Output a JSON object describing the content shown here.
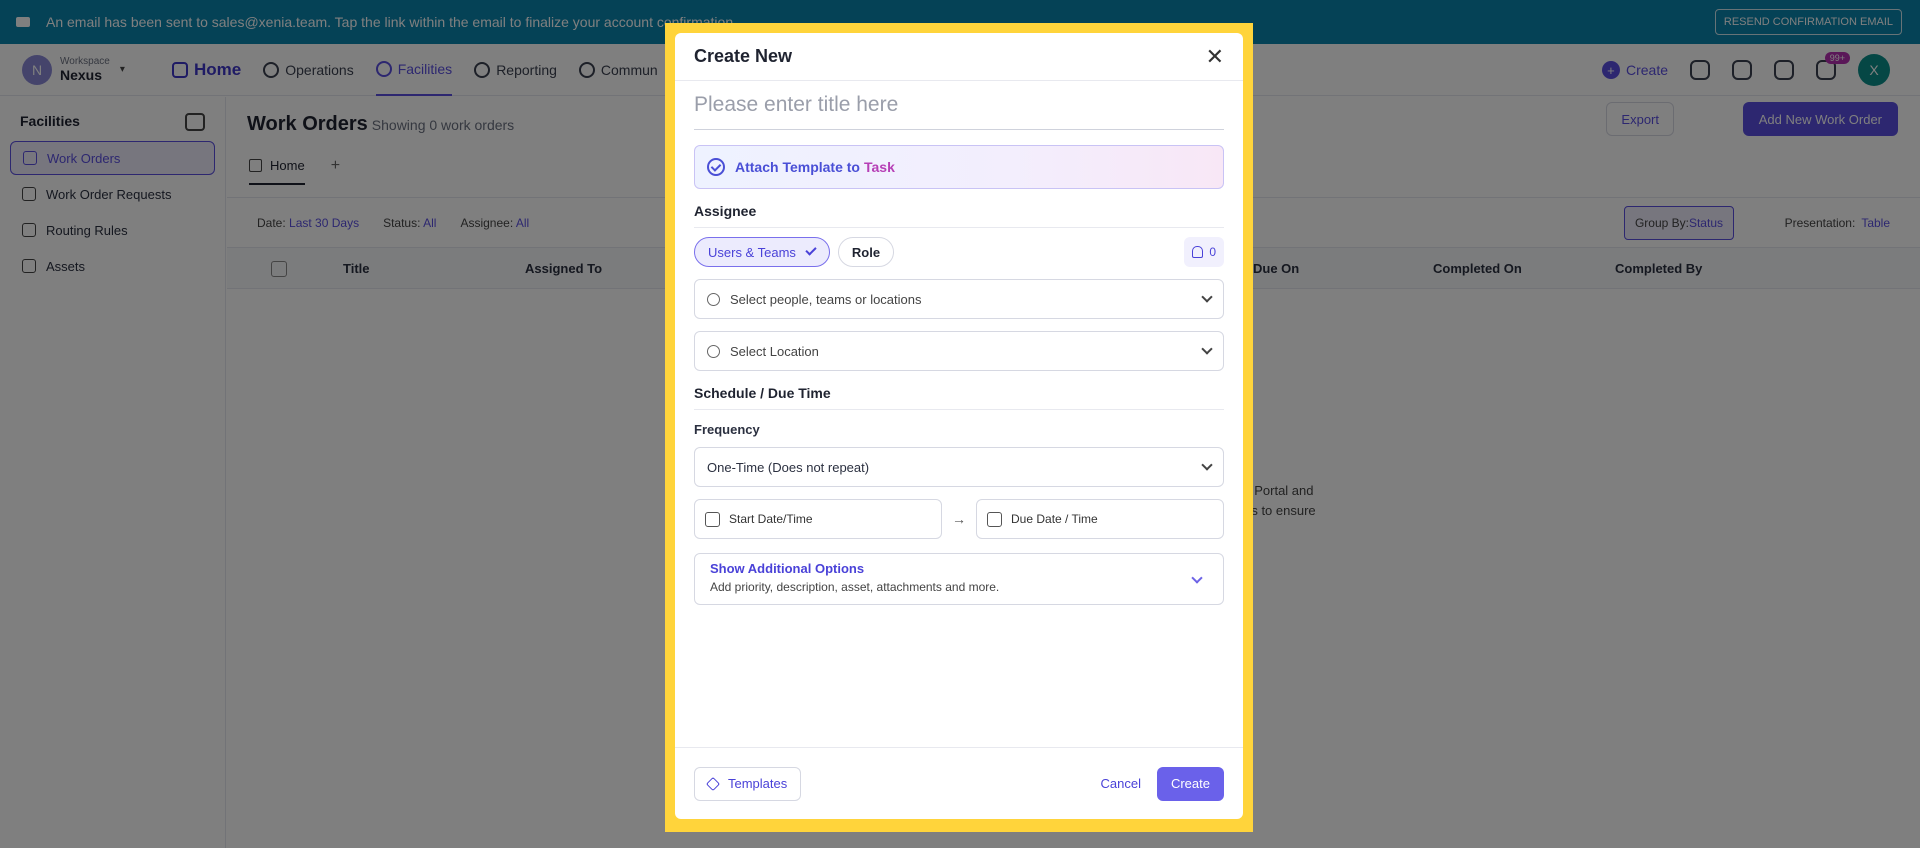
{
  "banner": {
    "message": "An email has been sent to sales@xenia.team. Tap the link within the email to finalize your account confirmation.",
    "resend_label": "RESEND CONFIRMATION EMAIL"
  },
  "workspace": {
    "label": "Workspace",
    "name": "Nexus",
    "initial": "N"
  },
  "nav": {
    "items": [
      {
        "label": "Home"
      },
      {
        "label": "Operations"
      },
      {
        "label": "Facilities"
      },
      {
        "label": "Reporting"
      },
      {
        "label": "Commun"
      }
    ],
    "create_label": "Create",
    "notification_badge": "99+",
    "user_initial": "X"
  },
  "sidebar": {
    "heading": "Facilities",
    "items": [
      {
        "label": "Work Orders"
      },
      {
        "label": "Work Order Requests"
      },
      {
        "label": "Routing Rules"
      },
      {
        "label": "Assets"
      }
    ]
  },
  "main": {
    "title": "Work Orders",
    "subtitle": "Showing 0 work orders",
    "export_label": "Export",
    "add_new_label": "Add New Work Order",
    "tab_home": "Home",
    "filters": {
      "date_label": "Date:",
      "date_value": "Last 30 Days",
      "status_label": "Status:",
      "status_value": "All",
      "assignee_label": "Assignee:",
      "assignee_value": "All",
      "group_label": "Group By:",
      "group_value": "Status",
      "presentation_label": "Presentation:",
      "presentation_value": "Table"
    },
    "columns": [
      "Title",
      "Assigned To",
      "Due On",
      "Completed On",
      "Completed By"
    ],
    "empty_line1": "t Portal and",
    "empty_line2": "rs to ensure"
  },
  "modal": {
    "title": "Create New",
    "title_placeholder": "Please enter title here",
    "attach_template": "Attach Template to",
    "attach_task": "Task",
    "assignee_heading": "Assignee",
    "users_teams_label": "Users & Teams",
    "role_label": "Role",
    "notify_count": "0",
    "select_people_placeholder": "Select people, teams or locations",
    "select_location_placeholder": "Select Location",
    "schedule_heading": "Schedule / Due Time",
    "frequency_label": "Frequency",
    "frequency_value": "One-Time (Does not repeat)",
    "start_placeholder": "Start Date/Time",
    "due_placeholder": "Due Date / Time",
    "more_title": "Show Additional Options",
    "more_desc": "Add priority, description, asset, attachments and more.",
    "templates_label": "Templates",
    "cancel_label": "Cancel",
    "create_label": "Create"
  },
  "colors": {
    "accent": "#5a4fe0",
    "banner": "#0b84ad",
    "highlight_frame": "#ffd43b"
  }
}
